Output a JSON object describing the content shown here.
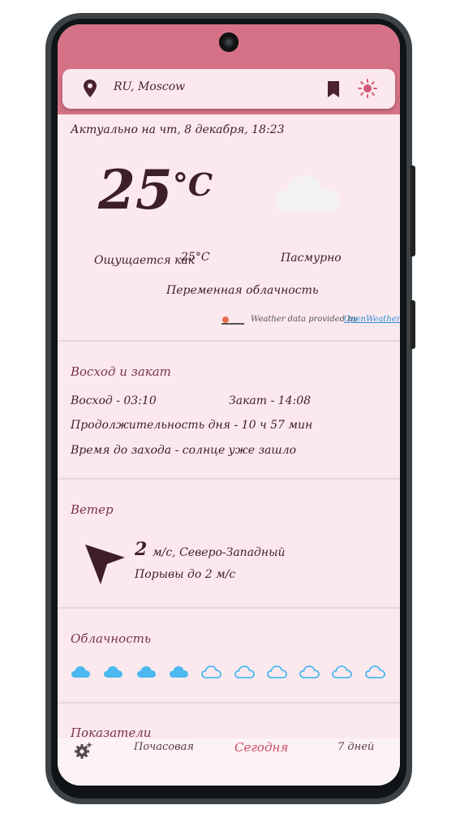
{
  "header": {
    "location": "RU, Moscow",
    "location_icon": "location-pin-icon",
    "bookmark_icon": "bookmark-icon",
    "theme_icon": "sun-icon",
    "accent_color": "#d57287"
  },
  "current": {
    "updated": "Актуально на чт, 8 декабря, 18:23",
    "temperature": "25",
    "unit": "°C",
    "feels_like_label": "Ощущается как",
    "feels_like_value": "25°C",
    "condition": "Пасмурно",
    "description": "Переменная облачность",
    "provider_text": "Weather data provided by",
    "provider_link": "OpenWeather",
    "condition_icon": "cloud-icon"
  },
  "sun": {
    "title": "Восход и закат",
    "sunrise": "Восход - 03:10",
    "sunset": "Закат - 14:08",
    "day_length": "Продолжительность дня - 10 ч 57 мин",
    "until_sunset": "Время до захода - солнце уже зашло"
  },
  "wind": {
    "title": "Ветер",
    "speed": "2",
    "unit_direction": "м/с, Северо-Западный",
    "gusts": "Порывы до 2 м/с",
    "direction_icon": "wind-arrow-icon"
  },
  "clouds": {
    "title": "Облачность",
    "filled": 4,
    "total": 10,
    "color": "#4cb8ef"
  },
  "indicators": {
    "title": "Показатели"
  },
  "nav": {
    "settings_icon": "settings-gear-icon",
    "hourly": "Почасовая",
    "today": "Сегодня",
    "week": "7 дней"
  }
}
